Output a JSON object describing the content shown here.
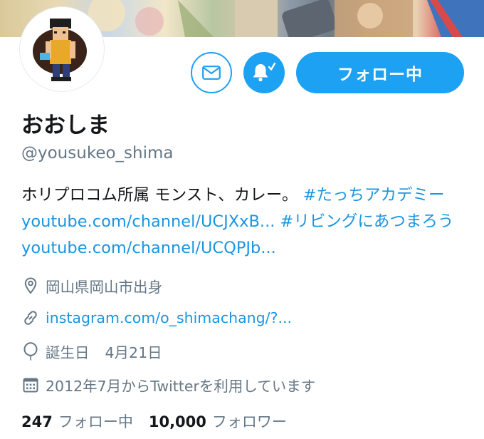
{
  "profile": {
    "name": "おおしま",
    "handle": "@yousukeo_shima",
    "bio": {
      "text1": "ホリプロコム所属 モンスト、カレー。",
      "hashtag1": "#たっちアカデミー",
      "link1": "youtube.com/channel/UCJXxB...",
      "hashtag2": "#リビングにあつまろう",
      "link2": "youtube.com/channel/UCQPJb..."
    },
    "location": "岡山県岡山市出身",
    "website": "instagram.com/o_shimachang/?...",
    "birthday_label": "誕生日",
    "birthday": "4月21日",
    "joined": "2012年7月からTwitterを利用しています"
  },
  "actions": {
    "follow_label": "フォロー中"
  },
  "stats": {
    "following_count": "247",
    "following_label": "フォロー中",
    "followers_count": "10,000",
    "followers_label": "フォロワー"
  },
  "icons": {
    "message": "envelope-icon",
    "notifications": "bell-check-icon",
    "location": "location-pin-icon",
    "website": "link-icon",
    "birthday": "balloon-icon",
    "joined": "calendar-icon"
  },
  "colors": {
    "accent": "#1da1f2",
    "link": "#1b95e0",
    "secondary_text": "#657786",
    "primary_text": "#14171a"
  }
}
